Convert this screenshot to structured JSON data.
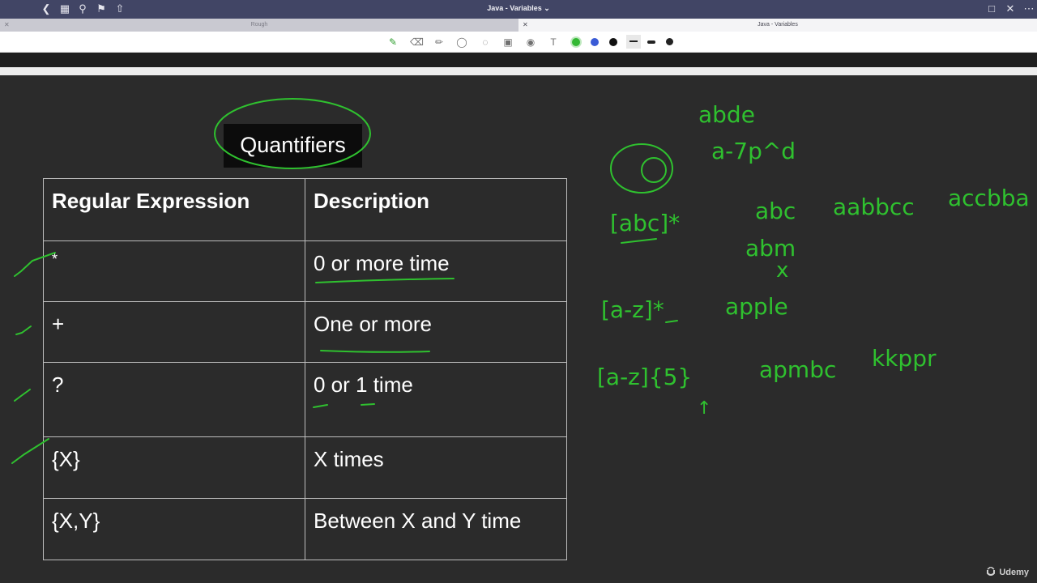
{
  "window": {
    "title": "Java - Variables ⌄"
  },
  "tabs": [
    {
      "label": "Rough",
      "active": false
    },
    {
      "label": "Java - Variables",
      "active": true
    }
  ],
  "toolbar": {
    "pen_colors": [
      "#33b833",
      "#3a5bd6",
      "#111111"
    ],
    "selected_color": "#33b833"
  },
  "slide": {
    "title": "Quantifiers",
    "table": {
      "headers": [
        "Regular Expression",
        "Description"
      ],
      "rows": [
        [
          "*",
          "0 or more time"
        ],
        [
          "+",
          "One or more"
        ],
        [
          "?",
          "0 or 1 time"
        ],
        [
          "{X}",
          "X times"
        ],
        [
          "{X,Y}",
          "Between X and Y time"
        ]
      ]
    }
  },
  "annotations": {
    "ink_color": "#2fc12f",
    "notes": [
      "abde",
      "a-7p^d",
      "[abc]*",
      "abc",
      "aabbcc",
      "accbba",
      "abm",
      "x",
      "[a-z]*",
      "apple",
      "[a-z]{5}",
      "apmbc",
      "kkppr",
      "↑"
    ]
  },
  "watermark": {
    "text": "Udemy"
  }
}
